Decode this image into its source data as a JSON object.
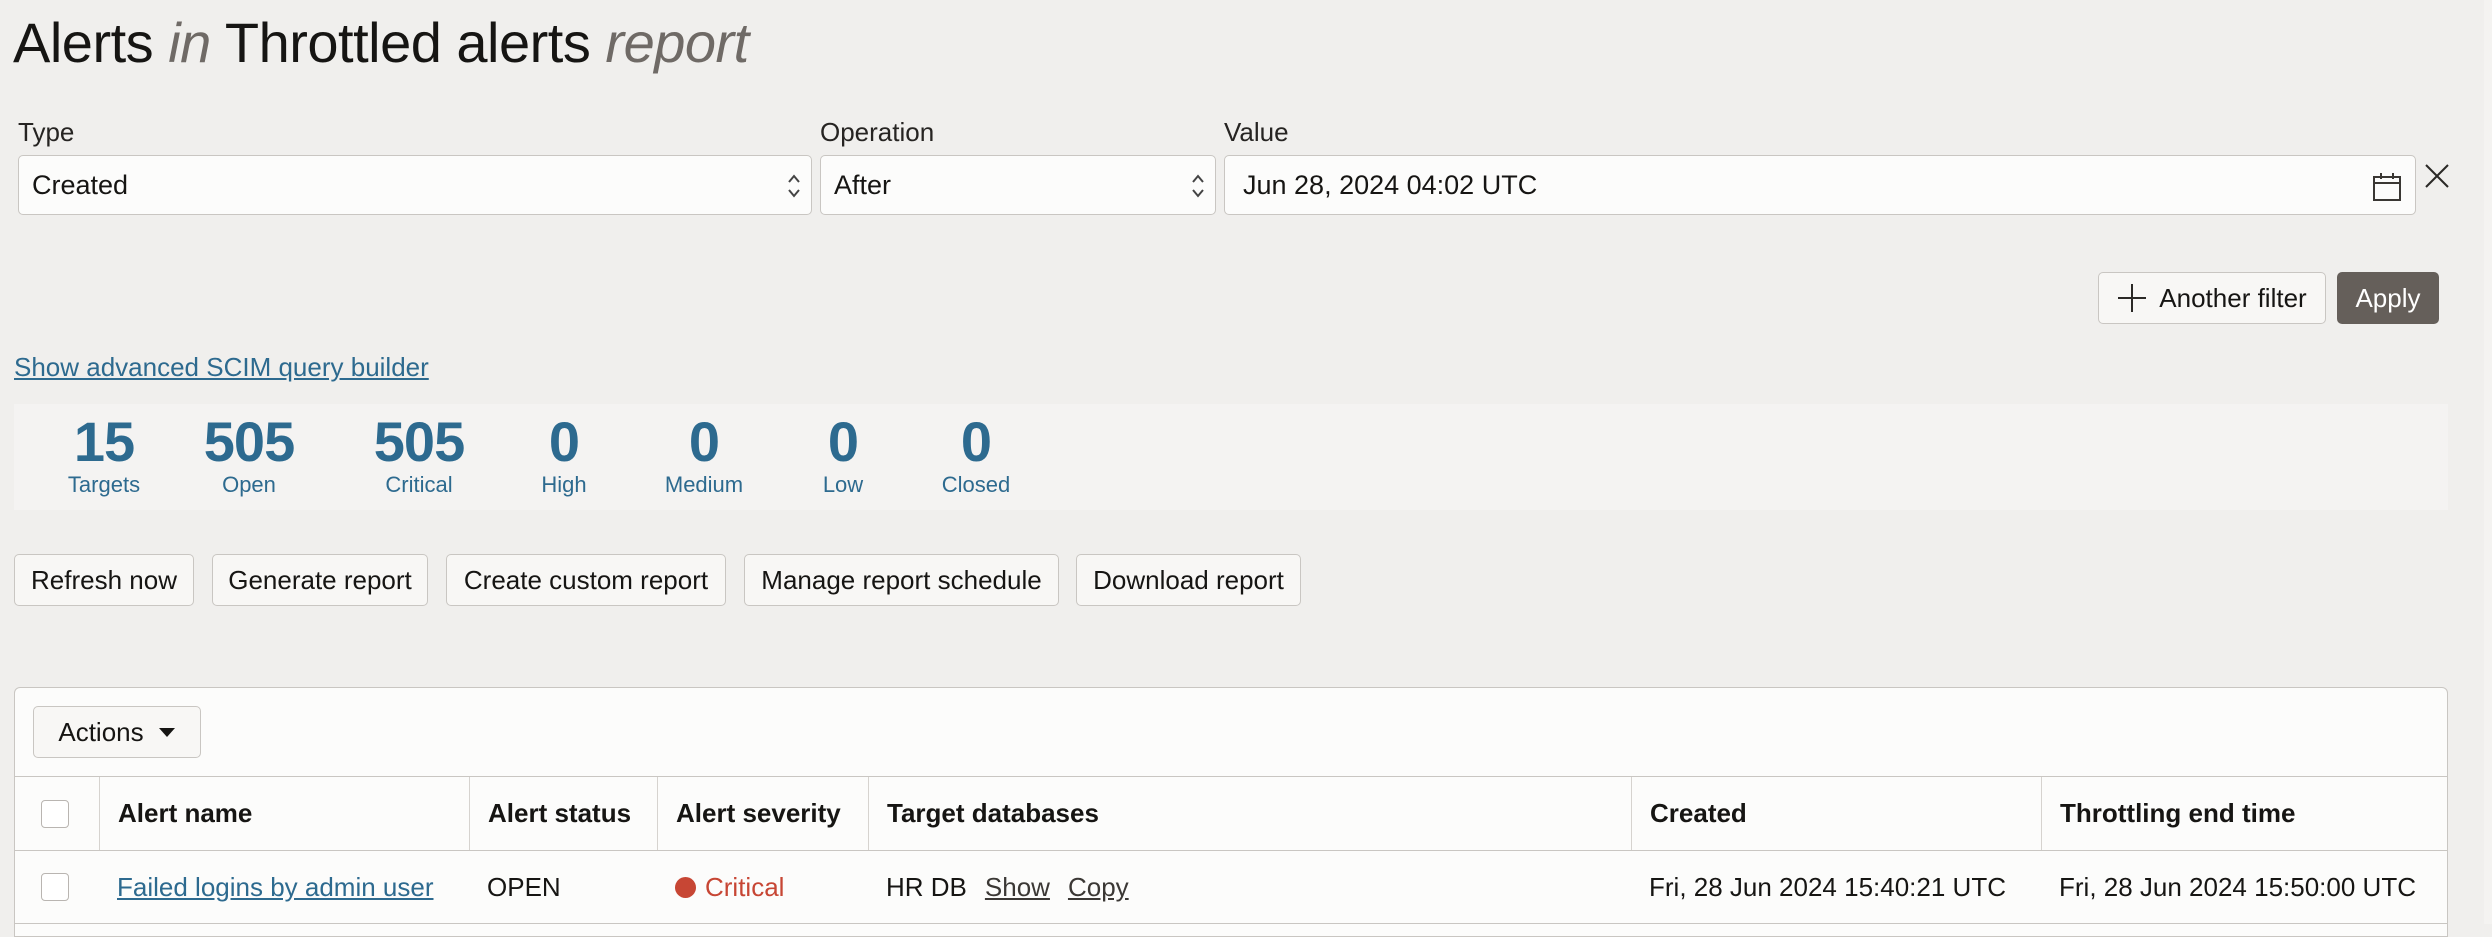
{
  "title": {
    "part1": "Alerts",
    "part2": "in",
    "part3": "Throttled alerts",
    "part4": "report"
  },
  "filter": {
    "type_label": "Type",
    "type_value": "Created",
    "operation_label": "Operation",
    "operation_value": "After",
    "value_label": "Value",
    "value_value": "Jun 28, 2024 04:02 UTC",
    "another_filter_label": "Another filter",
    "apply_label": "Apply"
  },
  "advanced_link": "Show advanced SCIM query builder",
  "stats": [
    {
      "value": "15",
      "label": "Targets"
    },
    {
      "value": "505",
      "label": "Open"
    },
    {
      "value": "505",
      "label": "Critical"
    },
    {
      "value": "0",
      "label": "High"
    },
    {
      "value": "0",
      "label": "Medium"
    },
    {
      "value": "0",
      "label": "Low"
    },
    {
      "value": "0",
      "label": "Closed"
    }
  ],
  "toolbar": {
    "refresh": "Refresh now",
    "generate": "Generate report",
    "custom": "Create custom report",
    "schedule": "Manage report schedule",
    "download": "Download report"
  },
  "table": {
    "actions_label": "Actions",
    "columns": [
      "Alert name",
      "Alert status",
      "Alert severity",
      "Target databases",
      "Created",
      "Throttling end time"
    ],
    "rows": [
      {
        "alert_name": "Failed logins by admin user",
        "status": "OPEN",
        "severity": "Critical",
        "target": "HR DB",
        "show": "Show",
        "copy": "Copy",
        "created": "Fri, 28 Jun 2024 15:40:21 UTC",
        "throttling_end": "Fri, 28 Jun 2024 15:50:00 UTC"
      }
    ]
  },
  "colors": {
    "accent": "#2d6a8f",
    "critical": "#c74634",
    "apply_bg": "#655f5a"
  }
}
